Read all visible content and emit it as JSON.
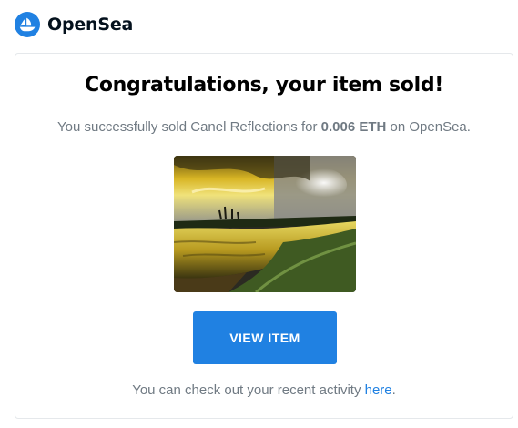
{
  "brand": {
    "name": "OpenSea",
    "logo_icon": "opensea-boat-icon",
    "accent_color": "#2081e2"
  },
  "email": {
    "title": "Congratulations, your item sold!",
    "sold_message": {
      "prefix": "You successfully sold Canel Reflections for ",
      "price": "0.006 ETH",
      "suffix": " on OpenSea."
    },
    "item_image": {
      "alt": "Canel Reflections"
    },
    "view_button_label": "VIEW ITEM",
    "activity_note": {
      "prefix": "You can check out your recent activity ",
      "link_text": "here",
      "suffix": "."
    }
  }
}
